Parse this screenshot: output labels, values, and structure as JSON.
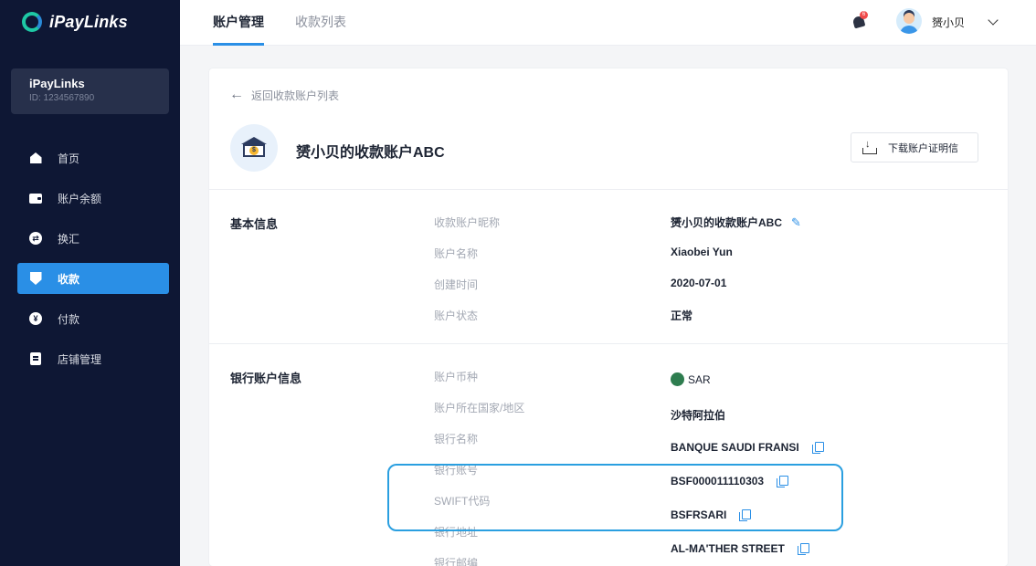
{
  "app": {
    "brand": "iPayLinks",
    "account_name": "iPayLinks",
    "account_id": "ID: 1234567890"
  },
  "sidebar": {
    "items": [
      {
        "label": "首页",
        "icon": "home-icon"
      },
      {
        "label": "账户余额",
        "icon": "wallet-icon"
      },
      {
        "label": "换汇",
        "icon": "exchange-icon"
      },
      {
        "label": "收款",
        "icon": "receive-icon",
        "active": true
      },
      {
        "label": "付款",
        "icon": "yen-icon"
      },
      {
        "label": "店铺管理",
        "icon": "store-icon"
      }
    ]
  },
  "header": {
    "tabs": [
      {
        "label": "账户管理",
        "active": true
      },
      {
        "label": "收款列表",
        "active": false
      }
    ],
    "notification_count": "6",
    "username": "赟小贝"
  },
  "page": {
    "back_label": "返回收款账户列表",
    "title": "赟小贝的收款账户ABC",
    "download_label": "下载账户证明信"
  },
  "basic_info": {
    "title": "基本信息",
    "fields": [
      {
        "label": "收款账户昵称",
        "value": "赟小贝的收款账户ABC"
      },
      {
        "label": "账户名称",
        "value": "Xiaobei Yun"
      },
      {
        "label": "创建时间",
        "value": "2020-07-01"
      },
      {
        "label": "账户状态",
        "value": "正常"
      }
    ]
  },
  "bank_info": {
    "title": "银行账户信息",
    "fields": [
      {
        "label": "账户币种",
        "value": "SAR"
      },
      {
        "label": "账户所在国家/地区",
        "value": "沙特阿拉伯"
      },
      {
        "label": "银行名称",
        "value": "BANQUE SAUDI FRANSI"
      },
      {
        "label": "银行账号",
        "value": "BSF000011110303"
      },
      {
        "label": "SWIFT代码",
        "value": "BSFRSARI"
      },
      {
        "label": "银行地址",
        "value": "AL-MA'THER STREET"
      },
      {
        "label": "银行邮编",
        "value": ""
      }
    ]
  },
  "colors": {
    "sidebar_bg": "#0e1734",
    "accent": "#2a8fe6",
    "highlight": "#2a9fe0"
  }
}
